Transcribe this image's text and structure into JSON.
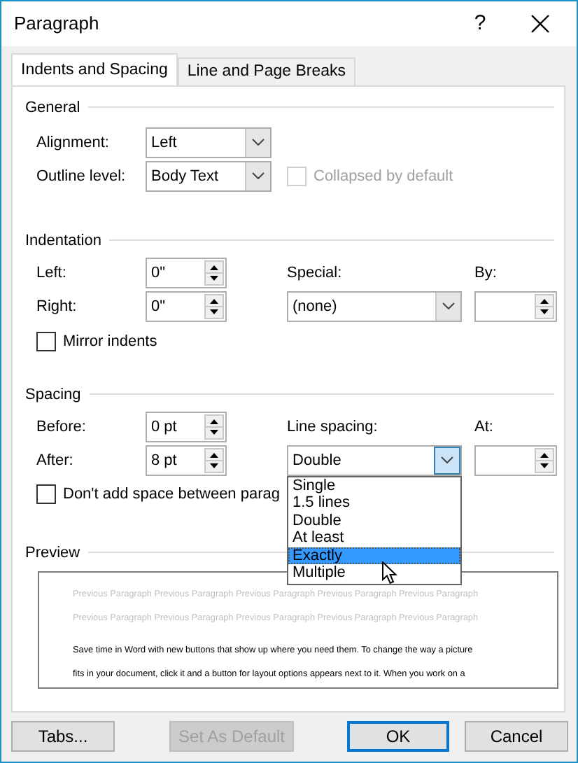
{
  "window": {
    "title": "Paragraph",
    "help": "?"
  },
  "tabs": [
    {
      "label": "Indents and Spacing",
      "selected": true
    },
    {
      "label": "Line and Page Breaks",
      "selected": false
    }
  ],
  "general": {
    "heading": "General",
    "alignment": {
      "label": "Alignment:",
      "value": "Left"
    },
    "outline_level": {
      "label": "Outline level:",
      "value": "Body Text"
    },
    "collapsed": {
      "label": "Collapsed by default",
      "checked": false,
      "disabled": true
    }
  },
  "indentation": {
    "heading": "Indentation",
    "left": {
      "label": "Left:",
      "value": "0\""
    },
    "right": {
      "label": "Right:",
      "value": "0\""
    },
    "special": {
      "label": "Special:",
      "value": "(none)"
    },
    "by": {
      "label": "By:"
    },
    "mirror": {
      "label": "Mirror indents",
      "checked": false
    }
  },
  "spacing": {
    "heading": "Spacing",
    "before": {
      "label": "Before:",
      "value": "0 pt"
    },
    "after": {
      "label": "After:",
      "value": "8 pt"
    },
    "line_spacing": {
      "label": "Line spacing:",
      "value": "Double",
      "expanded": true,
      "options": [
        {
          "label": "Single",
          "highlighted": false
        },
        {
          "label": "1.5 lines",
          "highlighted": false
        },
        {
          "label": "Double",
          "highlighted": false
        },
        {
          "label": "At least",
          "highlighted": false
        },
        {
          "label": "Exactly",
          "highlighted": true
        },
        {
          "label": "Multiple",
          "highlighted": false
        }
      ]
    },
    "at": {
      "label": "At:"
    },
    "dont_add": {
      "label": "Don't add space between parag",
      "checked": false
    }
  },
  "preview": {
    "heading": "Preview",
    "previous_lines": [
      "Previous Paragraph Previous Paragraph Previous Paragraph Previous Paragraph Previous Paragraph",
      "Previous Paragraph Previous Paragraph Previous Paragraph Previous Paragraph Previous Paragraph"
    ],
    "sample_lines": [
      "Save time in Word with new buttons that show up where you need them. To change the way a picture",
      "fits in your document, click it and a button for layout options appears next to it. When you work on a"
    ]
  },
  "buttons": [
    {
      "label": "Tabs...",
      "disabled": false,
      "default": false
    },
    {
      "label": "Set As Default",
      "disabled": true,
      "default": false
    },
    {
      "label": "OK",
      "disabled": false,
      "default": true
    },
    {
      "label": "Cancel",
      "disabled": false,
      "default": false
    }
  ]
}
